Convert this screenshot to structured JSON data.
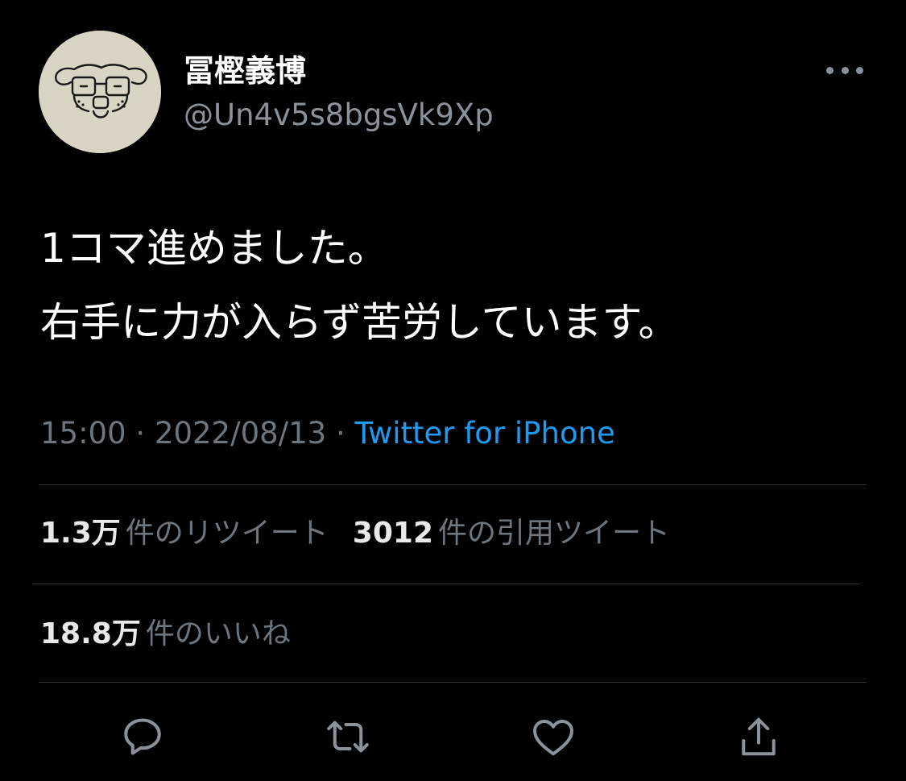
{
  "author": {
    "display_name": "冨樫義博",
    "handle": "@Un4v5s8bgsVk9Xp"
  },
  "tweet": {
    "lines": [
      "1コマ進めました。",
      "右手に力が入らず苦労しています。"
    ]
  },
  "meta": {
    "time": "15:00",
    "separator": "·",
    "date": "2022/08/13",
    "source": "Twitter for iPhone"
  },
  "stats": {
    "retweets": {
      "count": "1.3万",
      "label": "件のリツイート"
    },
    "quotes": {
      "count": "3012",
      "label": "件の引用ツイート"
    },
    "likes": {
      "count": "18.8万",
      "label": "件のいいね"
    }
  },
  "icons": {
    "more": "more-horizontal-icon",
    "reply": "reply-icon",
    "retweet": "retweet-icon",
    "like": "heart-icon",
    "share": "share-icon"
  },
  "colors": {
    "background": "#000000",
    "text": "#e7e9ea",
    "secondary": "#6e767d",
    "accent": "#1d9bf0",
    "divider": "#2f3336"
  }
}
